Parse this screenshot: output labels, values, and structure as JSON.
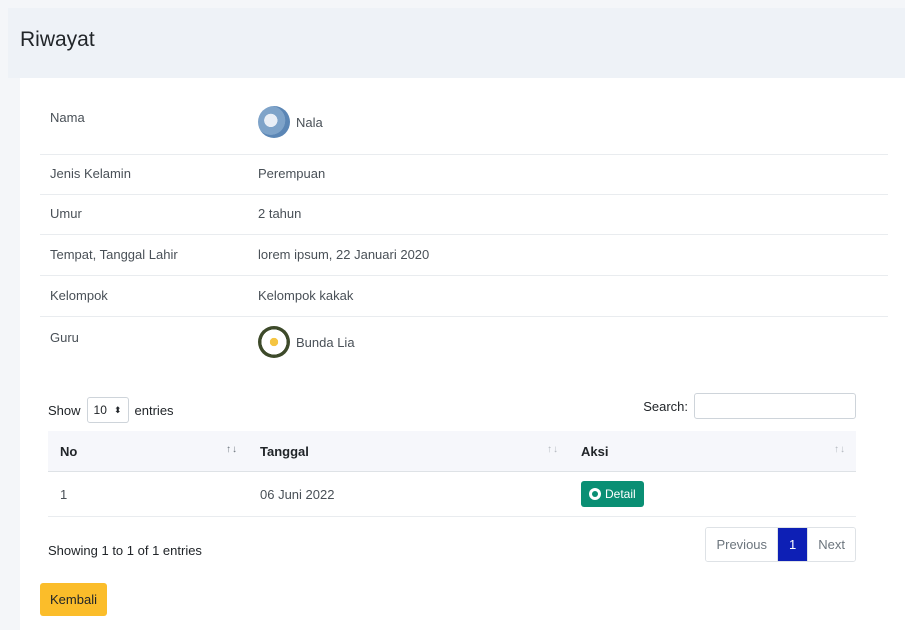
{
  "page": {
    "title": "Riwayat"
  },
  "profile": {
    "rows": [
      {
        "label": "Nama",
        "value": "Nala"
      },
      {
        "label": "Jenis Kelamin",
        "value": "Perempuan"
      },
      {
        "label": "Umur",
        "value": "2 tahun"
      },
      {
        "label": "Tempat, Tanggal Lahir",
        "value": "lorem ipsum, 22 Januari 2020"
      },
      {
        "label": "Kelompok",
        "value": "Kelompok kakak"
      },
      {
        "label": "Guru",
        "value": "Bunda Lia"
      }
    ]
  },
  "datatable": {
    "show_label": "Show",
    "entries_label": "entries",
    "page_length": "10",
    "search_label": "Search:",
    "search_value": "",
    "columns": [
      "No",
      "Tanggal",
      "Aksi"
    ],
    "sort_icon": "↑↓",
    "rows": [
      {
        "no": "1",
        "tanggal": "06 Juni 2022",
        "action_label": "Detail"
      }
    ],
    "info": "Showing 1 to 1 of 1 entries",
    "pagination": {
      "previous": "Previous",
      "current": "1",
      "next": "Next"
    }
  },
  "actions": {
    "back_label": "Kembali"
  },
  "colors": {
    "accent": "#0d1fb5",
    "detail_button": "#0a8f74",
    "back_button": "#fbbd2a"
  }
}
